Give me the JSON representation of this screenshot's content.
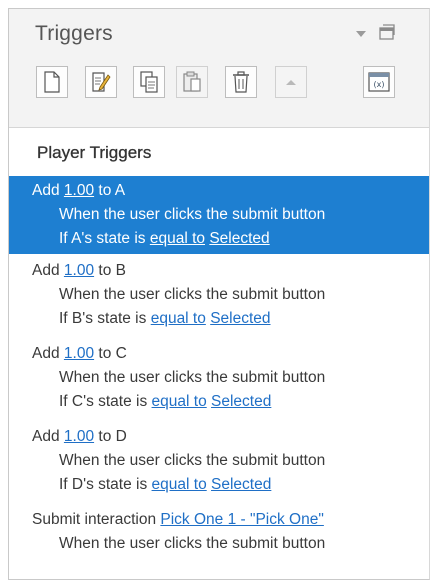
{
  "panel": {
    "title": "Triggers",
    "section_title": "Player Triggers"
  },
  "toolbar": {
    "buttons": [
      {
        "name": "new-trigger",
        "icon": "new-document-icon",
        "enabled": true
      },
      {
        "name": "edit-trigger",
        "icon": "edit-pencil-icon",
        "enabled": true
      },
      {
        "name": "copy-trigger",
        "icon": "copy-icon",
        "enabled": true
      },
      {
        "name": "paste-trigger",
        "icon": "paste-icon",
        "enabled": false
      },
      {
        "name": "delete-trigger",
        "icon": "trash-icon",
        "enabled": true
      },
      {
        "name": "move-up",
        "icon": "arrow-up-icon",
        "enabled": false
      },
      {
        "name": "variables",
        "icon": "variables-icon",
        "enabled": true
      }
    ]
  },
  "triggers": [
    {
      "selected": true,
      "action": "Add",
      "value": "1.00",
      "target_prefix": "to",
      "target": "A",
      "when": "When the user clicks the submit button",
      "cond_prefix": "If A's state is",
      "cond_op": "equal to",
      "cond_val": "Selected"
    },
    {
      "selected": false,
      "action": "Add",
      "value": "1.00",
      "target_prefix": "to",
      "target": "B",
      "when": "When the user clicks the submit button",
      "cond_prefix": "If B's state is",
      "cond_op": "equal to",
      "cond_val": "Selected"
    },
    {
      "selected": false,
      "action": "Add",
      "value": "1.00",
      "target_prefix": "to",
      "target": "C",
      "when": "When the user clicks the submit button",
      "cond_prefix": "If C's state is",
      "cond_op": "equal to",
      "cond_val": "Selected"
    },
    {
      "selected": false,
      "action": "Add",
      "value": "1.00",
      "target_prefix": "to",
      "target": "D",
      "when": "When the user clicks the submit button",
      "cond_prefix": "If D's state is",
      "cond_op": "equal to",
      "cond_val": "Selected"
    }
  ],
  "submit_trigger": {
    "action": "Submit interaction",
    "interaction": "Pick One 1 - \"Pick One\"",
    "when": "When the user clicks the submit button"
  },
  "colors": {
    "selection": "#1e7fd1",
    "link": "#1f6fc6",
    "header_bg": "#f3f3f3"
  }
}
